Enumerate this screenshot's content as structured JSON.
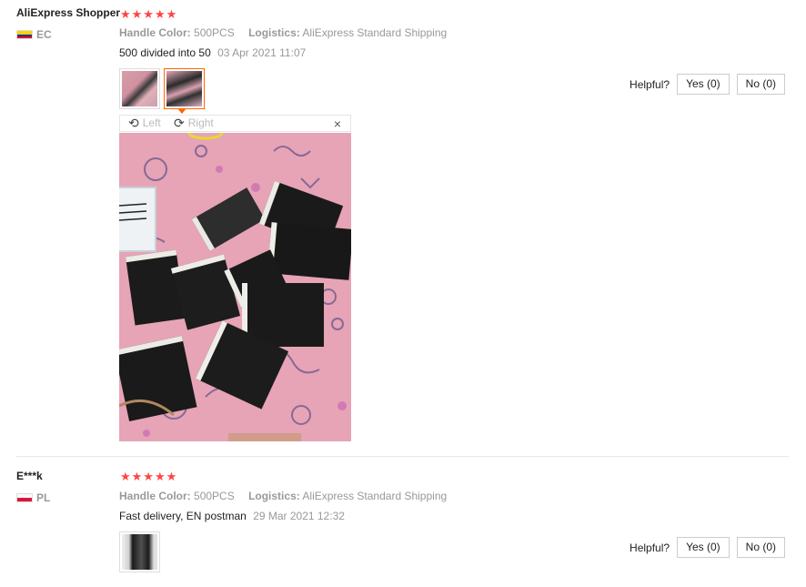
{
  "reviews": [
    {
      "user": "AliExpress Shopper",
      "country": "EC",
      "stars": "★★★★★",
      "attr1_key": "Handle Color:",
      "attr1_val": "500PCS",
      "attr2_key": "Logistics:",
      "attr2_val": "AliExpress Standard Shipping",
      "text": "500 divided into 50",
      "date": "03 Apr 2021 11:07",
      "helpful_label": "Helpful?",
      "yes_label": "Yes (0)",
      "no_label": "No (0)"
    },
    {
      "user": "E***k",
      "country": "PL",
      "stars": "★★★★★",
      "attr1_key": "Handle Color:",
      "attr1_val": "500PCS",
      "attr2_key": "Logistics:",
      "attr2_val": "AliExpress Standard Shipping",
      "text": "Fast delivery, EN postman",
      "date": "29 Mar 2021 12:32",
      "helpful_label": "Helpful?",
      "yes_label": "Yes (0)",
      "no_label": "No (0)"
    }
  ],
  "viewer": {
    "left_label": "Left",
    "right_label": "Right",
    "close_glyph": "×",
    "rotate_left_icon": "⟲",
    "rotate_right_icon": "⟳"
  },
  "colors": {
    "star": "#ff4444",
    "active_thumb": "#ff6600"
  }
}
